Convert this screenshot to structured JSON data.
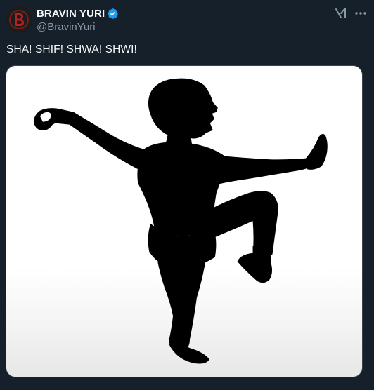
{
  "author": {
    "display_name": "BRAVIN YURI",
    "handle": "@BravinYuri",
    "verified": true,
    "avatar_icon": "avatar-logo-icon"
  },
  "header_actions": {
    "grok_icon": "grok-icon",
    "more_icon": "more-icon"
  },
  "post": {
    "text": "SHA! SHIF! SHWA! SHWI!",
    "media_description_icon": "kung-fu-silhouette"
  },
  "colors": {
    "background": "#15202b",
    "text_primary": "#f7f9f9",
    "text_secondary": "#8b98a5",
    "verified_badge": "#1d9bf0"
  }
}
